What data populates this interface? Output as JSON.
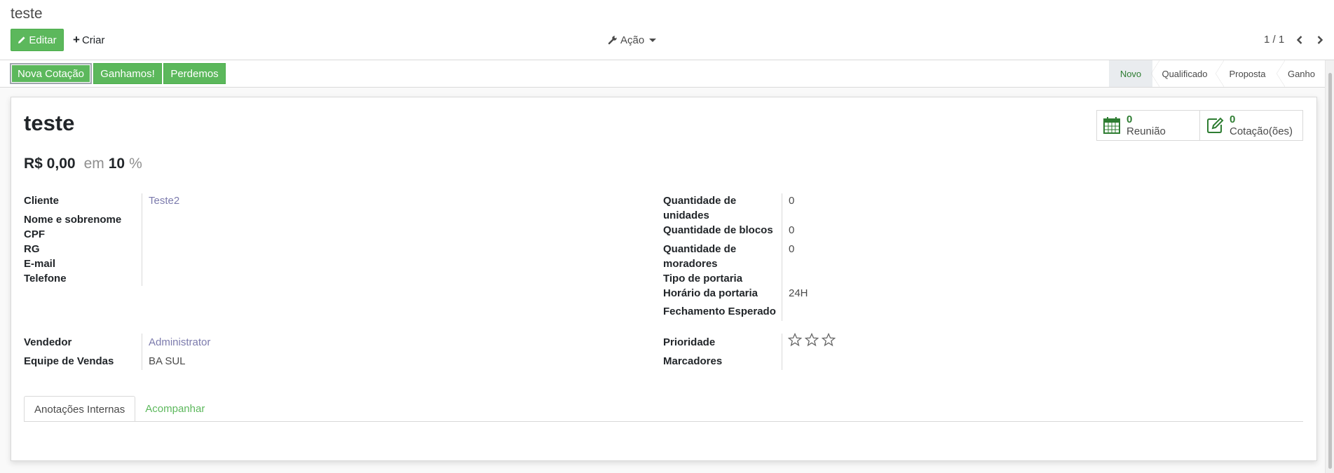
{
  "breadcrumb": "teste",
  "toolbar": {
    "edit_label": "Editar",
    "create_label": "Criar",
    "action_label": "Ação",
    "pager": "1 / 1"
  },
  "statusbar": {
    "new_quotation": "Nova Cotação",
    "won": "Ganhamos!",
    "lost": "Perdemos",
    "stages": [
      "Novo",
      "Qualificado",
      "Proposta",
      "Ganho"
    ],
    "active_stage": "Novo"
  },
  "record": {
    "title": "teste",
    "revenue": "R$ 0,00",
    "at_label": "em",
    "probability": "10",
    "percent_sign": "%"
  },
  "smart_buttons": {
    "meeting": {
      "count": "0",
      "label": "Reunião"
    },
    "quotation": {
      "count": "0",
      "label": "Cotação(ões)"
    }
  },
  "left_group": {
    "customer_label": "Cliente",
    "customer_value": "Teste2",
    "name_label": "Nome e sobrenome",
    "cpf_label": "CPF",
    "rg_label": "RG",
    "email_label": "E-mail",
    "phone_label": "Telefone"
  },
  "right_group": {
    "units_label": "Quantidade de unidades",
    "units_value": "0",
    "blocks_label": "Quantidade de blocos",
    "blocks_value": "0",
    "residents_label": "Quantidade de moradores",
    "residents_value": "0",
    "gate_type_label": "Tipo de portaria",
    "gate_hours_label": "Horário da portaria",
    "gate_hours_value": "24H",
    "expected_close_label": "Fechamento Esperado"
  },
  "sales_group": {
    "salesperson_label": "Vendedor",
    "salesperson_value": "Administrator",
    "team_label": "Equipe de Vendas",
    "team_value": "BA SUL"
  },
  "priority_group": {
    "priority_label": "Prioridade",
    "priority_stars": 0,
    "priority_max": 3,
    "tags_label": "Marcadores"
  },
  "tabs": [
    "Anotações Internas",
    "Acompanhar"
  ],
  "colors": {
    "primary": "#5cb85c",
    "link": "#7c7bad",
    "count": "#2e7d32"
  },
  "icons": [
    "pencil-icon",
    "plus-icon",
    "wrench-icon",
    "chevron-left-icon",
    "chevron-right-icon",
    "calendar-icon",
    "edit-icon",
    "star-icon"
  ]
}
